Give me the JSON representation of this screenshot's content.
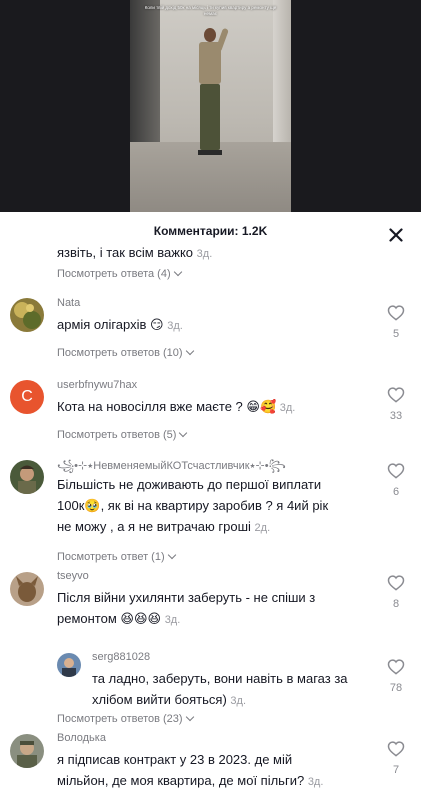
{
  "video": {
    "caption": "Коли твій дохід 50к на місяць і ти купив квартиру а ремонту ще немає"
  },
  "sheet": {
    "title": "Комментарии: 1.2K"
  },
  "partial_comment": {
    "text": "язвіть, і так всім важко",
    "time": "3д.",
    "replies": "Посмотреть ответа (4)"
  },
  "comments": [
    {
      "username": "Nata",
      "text": "армія олігархів 😏",
      "time": "3д.",
      "likes": "5",
      "replies": "Посмотреть ответов (10)"
    },
    {
      "username": "userbfnywu7hax",
      "avatar_letter": "C",
      "text": "Кота на новосілля вже маєте ? 😁🥰",
      "time": "3д.",
      "likes": "33",
      "replies": "Посмотреть ответов (5)"
    },
    {
      "username": "꧁•⊹٭НевменяемыйКОТсчастливчик٭⊹•꧂",
      "text_lines": [
        "Більшість не доживають до першої виплати",
        "100к🥹, як ві на квартиру заробив ? я 4ий рік",
        "не можу , а я не витрачаю гроші"
      ],
      "time": "2д.",
      "likes": "6",
      "replies": "Посмотреть ответ (1)"
    },
    {
      "username": "tseyvo",
      "text_lines": [
        "Після війни ухилянти заберуть - не спіши з",
        "ремонтом 😆😆😆"
      ],
      "time": "3д.",
      "likes": "8",
      "reply": {
        "username": "serg881028",
        "text_lines": [
          "та ладно, заберуть, вони навіть в магаз за",
          "хлібом вийти бояться)"
        ],
        "time": "3д.",
        "likes": "78"
      },
      "replies": "Посмотреть ответов (23)"
    },
    {
      "username": "Володька",
      "text_lines": [
        "я підписав контракт у 23 в 2023. де мій",
        "мільйон, де моя квартира, де мої пільги?"
      ],
      "time": "3д.",
      "likes": "7"
    }
  ],
  "colors": {
    "text": "#161823",
    "secondary": "#7a7b81",
    "avatar_c": "#e8542e"
  },
  "icons": [
    "close-icon",
    "heart-icon",
    "chevron-down-icon"
  ]
}
